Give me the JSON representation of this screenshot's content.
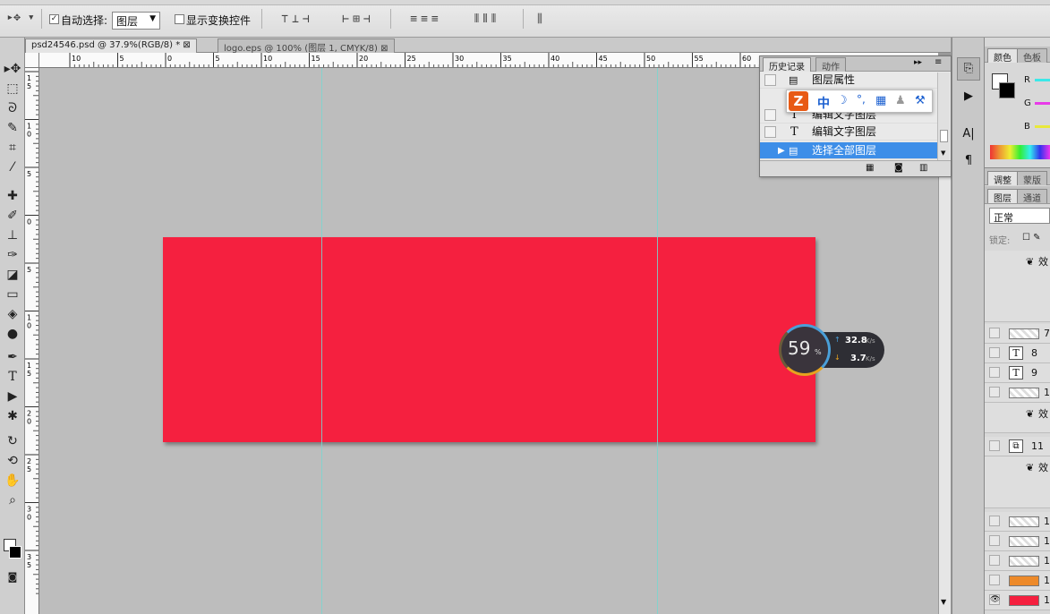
{
  "optionsBar": {
    "autoSelectLabel": "自动选择:",
    "autoSelectDropdown": "图层",
    "showTransformLabel": "显示变换控件"
  },
  "tabs": [
    {
      "label": "psd24546.psd @ 37.9%(RGB/8) *"
    },
    {
      "label": "logo.eps @ 100% (图层 1, CMYK/8)"
    }
  ],
  "rulerH": [
    "10",
    "5",
    "0",
    "5",
    "10",
    "15",
    "20",
    "25",
    "30",
    "35",
    "40",
    "45",
    "50",
    "55",
    "60"
  ],
  "rulerV": [
    "1 5",
    "1 0",
    "5",
    "0",
    "5",
    "1 0",
    "1 5",
    "2 0",
    "2 5",
    "3 0",
    "3 5"
  ],
  "history": {
    "tabs": [
      "历史记录",
      "动作"
    ],
    "items": [
      "图层属性",
      "编辑文字图层",
      "编辑文字图层",
      "选择全部图层"
    ]
  },
  "ime": {
    "mode": "中"
  },
  "gauge": {
    "percent": "59",
    "unit": "%",
    "up": "32.8",
    "upUnit": "K/s",
    "down": "3.7",
    "downUnit": "K/s"
  },
  "colorPanel": {
    "tabs": [
      "颜色",
      "色板"
    ],
    "channels": [
      "R",
      "G",
      "B"
    ]
  },
  "layersPanel": {
    "tabs1": [
      "调整",
      "蒙版"
    ],
    "tabs2": [
      "图层",
      "通道"
    ],
    "blendMode": "正常",
    "lockLabel": "锁定:",
    "rows": [
      {
        "label": "效"
      },
      {
        "label": "7"
      },
      {
        "label": "8",
        "type": "text"
      },
      {
        "label": "9",
        "type": "text"
      },
      {
        "label": "1"
      },
      {
        "label": "效"
      },
      {
        "label": "11"
      },
      {
        "label": "效"
      },
      {
        "label": "1"
      },
      {
        "label": "1"
      },
      {
        "label": "1"
      },
      {
        "label": "1"
      },
      {
        "label": "1"
      }
    ]
  },
  "colors": {
    "doc": "#f5203f",
    "guide": "#7ad6d0",
    "highlight": "#3d8ee8"
  }
}
